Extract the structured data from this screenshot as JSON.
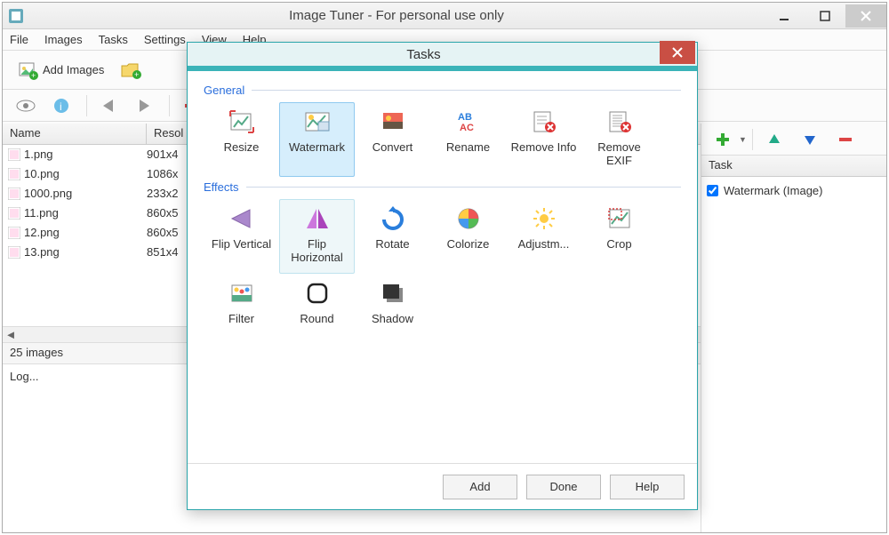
{
  "title": "Image Tuner - For personal use only",
  "menu": [
    "File",
    "Images",
    "Tasks",
    "Settings",
    "View",
    "Help"
  ],
  "toolbar1": {
    "add_images": "Add Images"
  },
  "columns": {
    "name": "Name",
    "resolution": "Resol"
  },
  "files": [
    {
      "name": "1.png",
      "res": "901x4"
    },
    {
      "name": "10.png",
      "res": "1086x"
    },
    {
      "name": "1000.png",
      "res": "233x2"
    },
    {
      "name": "11.png",
      "res": "860x5"
    },
    {
      "name": "12.png",
      "res": "860x5"
    },
    {
      "name": "13.png",
      "res": "851x4"
    }
  ],
  "status": "25 images",
  "log": "Log...",
  "right": {
    "header": "Task",
    "tasks": [
      {
        "label": "Watermark (Image)",
        "checked": true
      }
    ]
  },
  "modal": {
    "title": "Tasks",
    "sections": {
      "general_label": "General",
      "effects_label": "Effects"
    },
    "general": [
      {
        "k": "resize",
        "label": "Resize"
      },
      {
        "k": "watermark",
        "label": "Watermark"
      },
      {
        "k": "convert",
        "label": "Convert"
      },
      {
        "k": "rename",
        "label": "Rename"
      },
      {
        "k": "removeinfo",
        "label": "Remove Info"
      },
      {
        "k": "removeexif",
        "label": "Remove EXIF"
      }
    ],
    "effects": [
      {
        "k": "flipv",
        "label": "Flip Vertical"
      },
      {
        "k": "fliph",
        "label": "Flip Horizontal"
      },
      {
        "k": "rotate",
        "label": "Rotate"
      },
      {
        "k": "colorize",
        "label": "Colorize"
      },
      {
        "k": "adjust",
        "label": "Adjustm..."
      },
      {
        "k": "crop",
        "label": "Crop"
      },
      {
        "k": "filter",
        "label": "Filter"
      },
      {
        "k": "round",
        "label": "Round"
      },
      {
        "k": "shadow",
        "label": "Shadow"
      }
    ],
    "buttons": {
      "add": "Add",
      "done": "Done",
      "help": "Help"
    }
  }
}
